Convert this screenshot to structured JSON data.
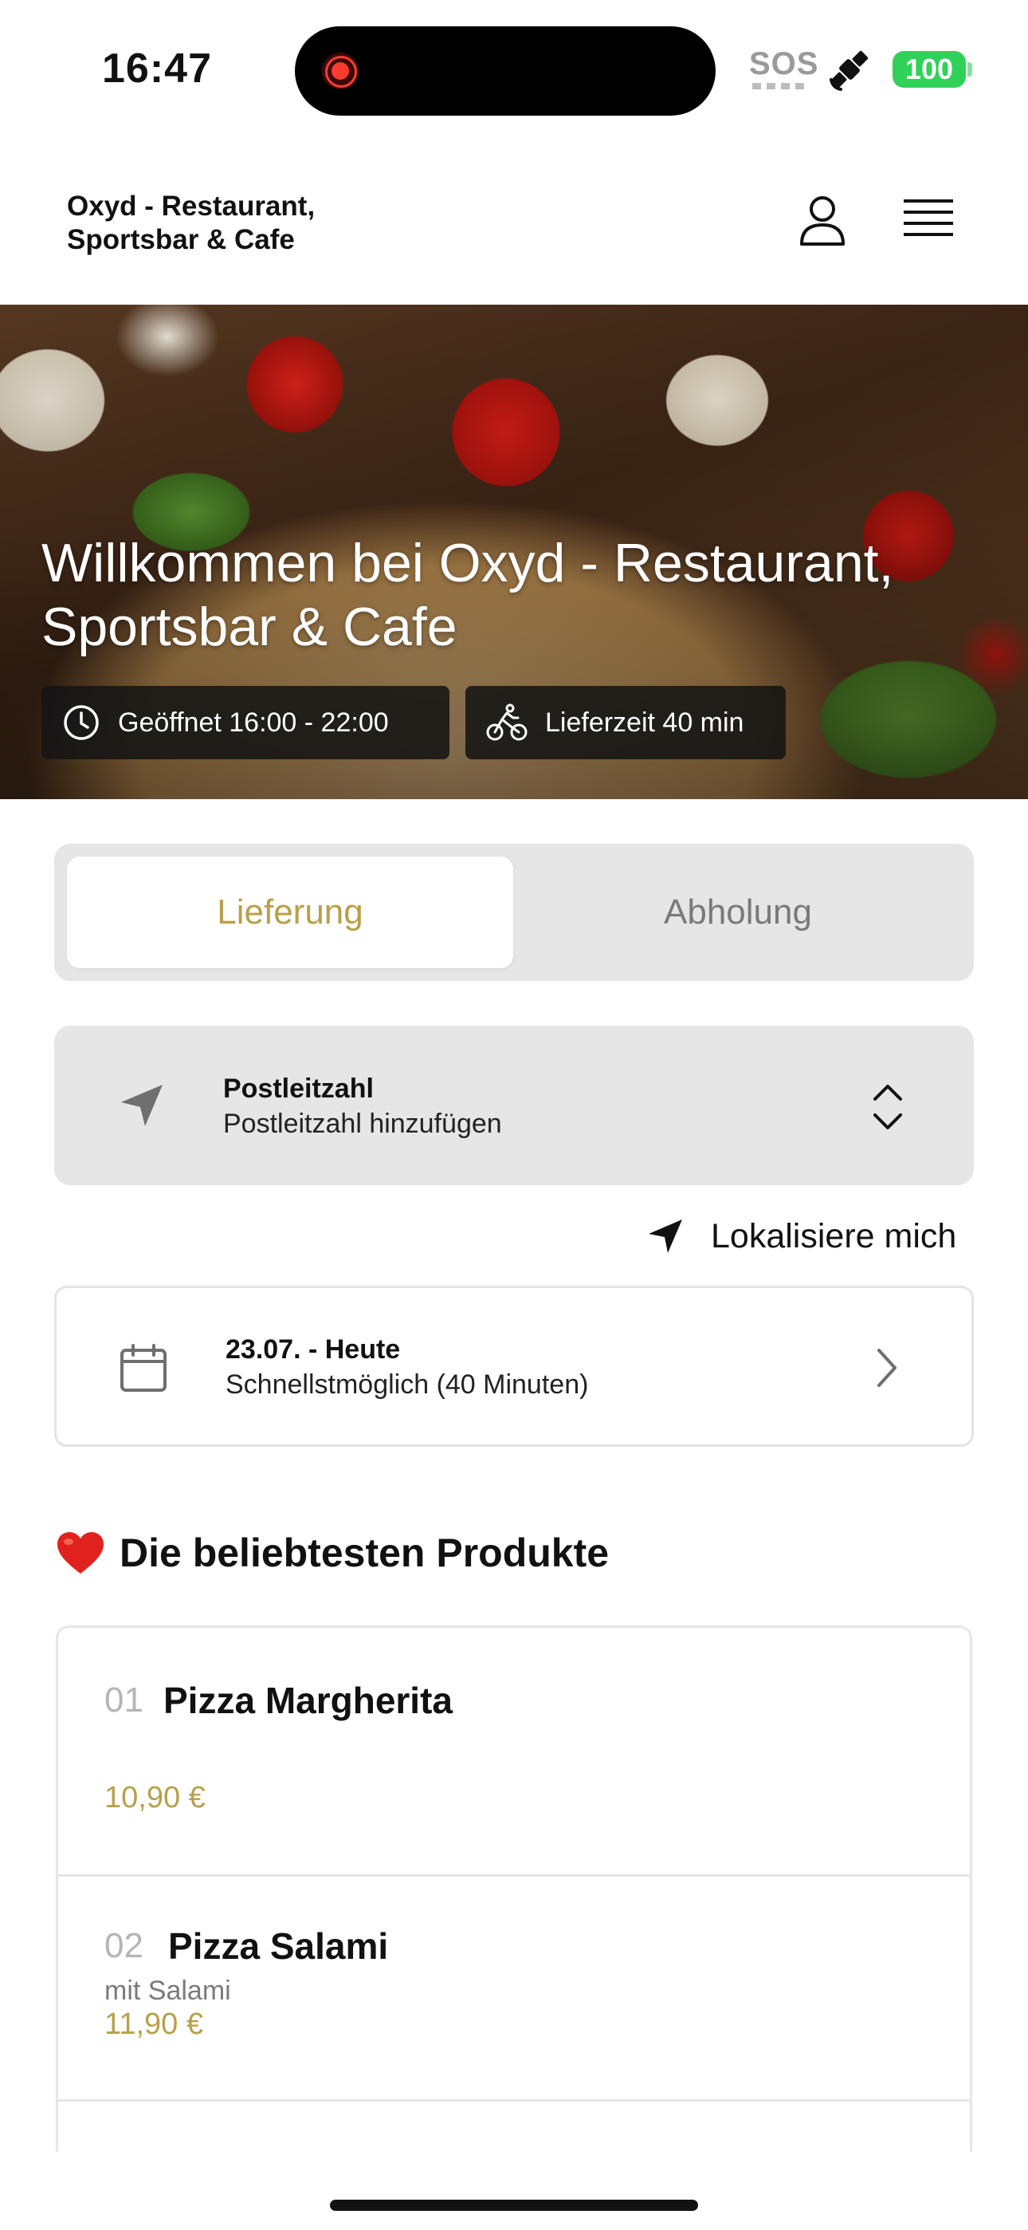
{
  "status_bar": {
    "time": "16:47",
    "sos": "SOS",
    "battery": "100"
  },
  "header": {
    "brand": "Oxyd - Restaurant, Sportsbar & Cafe",
    "icons": [
      "user-icon",
      "hamburger-menu-icon"
    ]
  },
  "hero": {
    "title": "Willkommen bei Oxyd - Restaurant, Sportsbar & Cafe",
    "open_hours": "Geöffnet 16:00 - 22:00",
    "delivery_time": "Lieferzeit 40 min"
  },
  "mode_toggle": {
    "delivery": "Lieferung",
    "pickup": "Abholung",
    "selected": "Lieferung",
    "accent_color": "#b8a04a"
  },
  "postcode": {
    "label": "Postleitzahl",
    "value": "Postleitzahl hinzufügen"
  },
  "locate": {
    "label": "Lokalisiere mich"
  },
  "date": {
    "title": "23.07. - Heute",
    "subtitle": "Schnellstmöglich (40 Minuten)"
  },
  "popular": {
    "title": "Die beliebtesten Produkte",
    "products": [
      {
        "number": "01",
        "name": "Pizza Margherita",
        "description": "",
        "price": "10,90 €"
      },
      {
        "number": "02",
        "name": "Pizza Salami",
        "description": "mit Salami",
        "price": "11,90 €"
      }
    ]
  }
}
